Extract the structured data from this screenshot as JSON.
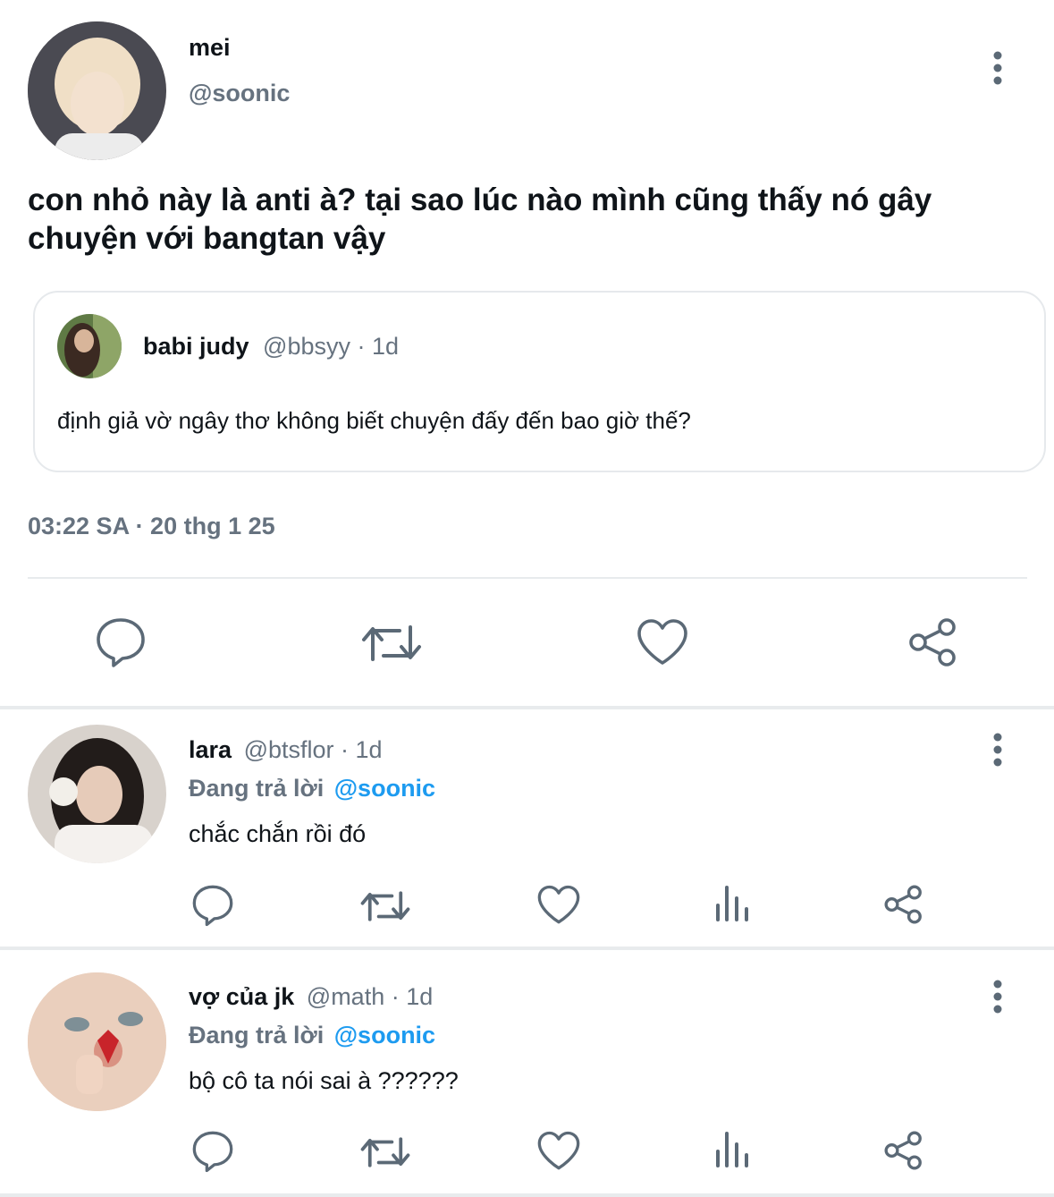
{
  "main_tweet": {
    "author": {
      "display_name": "mei",
      "handle": "@soonic"
    },
    "text_line1": "con nhỏ này là anti à? tại sao lúc nào mình cũng thấy nó gây",
    "text_line2": "chuyện với bangtan vậy",
    "quoted": {
      "display_name": "babi judy",
      "handle": "@bbsyy",
      "sep": "·",
      "age": "1d",
      "text": "định giả vờ ngây thơ không biết chuyện đấy đến bao giờ thế?"
    },
    "timestamp": "03:22 SA · 20 thg 1 25"
  },
  "replies": [
    {
      "display_name": "lara",
      "handle": "@btsflor",
      "sep": "·",
      "age": "1d",
      "replying_label": "Đang trả lời",
      "replying_to": "@soonic",
      "text": "chắc chắn rồi đó"
    },
    {
      "display_name": "vợ của jk",
      "handle": "@math",
      "sep": "·",
      "age": "1d",
      "replying_label": "Đang trả lời",
      "replying_to": "@soonic",
      "text": "bộ cô ta nói sai à ??????"
    }
  ],
  "icons": {
    "reply": "reply-icon",
    "retweet": "retweet-icon",
    "like": "heart-icon",
    "views": "views-icon",
    "share": "share-icon",
    "more": "more-icon"
  },
  "colors": {
    "link": "#1d9bf0",
    "muted": "#66727f",
    "icon": "#5b6976",
    "divider": "#e8ebed"
  }
}
